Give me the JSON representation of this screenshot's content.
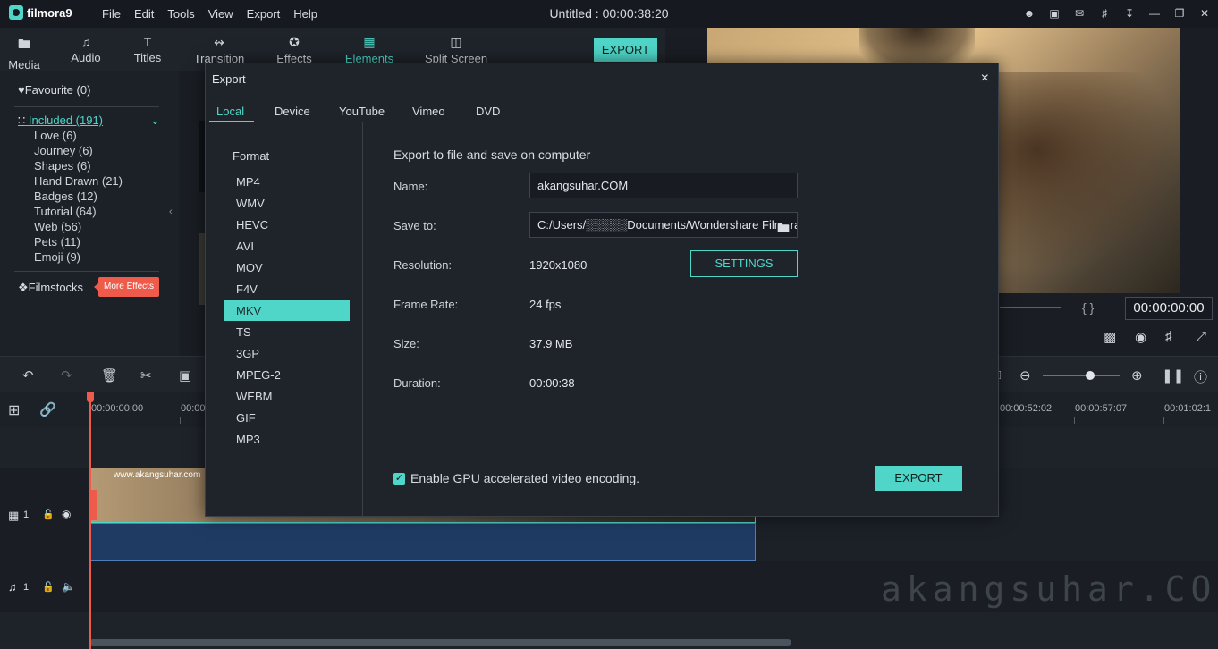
{
  "app": {
    "logo_text": "filmora9",
    "window_title": "Untitled : 00:00:38:20",
    "menu": [
      "File",
      "Edit",
      "Tools",
      "View",
      "Export",
      "Help"
    ]
  },
  "toolbar": {
    "tools": [
      "Media",
      "Audio",
      "Titles",
      "Transition",
      "Effects",
      "Elements",
      "Split Screen"
    ],
    "active": "Elements",
    "export_label": "EXPORT"
  },
  "library": {
    "favourite": "Favourite (0)",
    "included": "Included (191)",
    "categories": [
      "Love (6)",
      "Journey (6)",
      "Shapes (6)",
      "Hand Drawn (21)",
      "Badges (12)",
      "Tutorial (64)",
      "Web (56)",
      "Pets (11)",
      "Emoji (9)"
    ],
    "filmstocks": "Filmstocks",
    "more_effects": "More Effects"
  },
  "preview": {
    "timecode": "00:00:00:00",
    "braces": "{  }"
  },
  "timeline": {
    "ruler_labels": [
      "00:00:00:00",
      "00:00",
      "00:00:52:02",
      "00:00:57:07",
      "00:01:02:1"
    ],
    "video_track_label": "1",
    "audio_track_label": "1",
    "clip_watermark": "www.akangsuhar.com"
  },
  "watermark": "akangsuhar.COM",
  "dialog": {
    "title": "Export",
    "close": "×",
    "tabs": [
      "Local",
      "Device",
      "YouTube",
      "Vimeo",
      "DVD"
    ],
    "active_tab": "Local",
    "format_heading": "Format",
    "formats": [
      "MP4",
      "WMV",
      "HEVC",
      "AVI",
      "MOV",
      "F4V",
      "MKV",
      "TS",
      "3GP",
      "MPEG-2",
      "WEBM",
      "GIF",
      "MP3"
    ],
    "selected_format": "MKV",
    "heading": "Export to file and save on computer",
    "name_label": "Name:",
    "name_value": "akangsuhar.COM",
    "saveto_label": "Save to:",
    "saveto_value": "C:/Users/░░░░░Documents/Wondershare Filmora",
    "resolution_label": "Resolution:",
    "resolution_value": "1920x1080",
    "settings_label": "SETTINGS",
    "framerate_label": "Frame Rate:",
    "framerate_value": "24 fps",
    "size_label": "Size:",
    "size_value": "37.9 MB",
    "duration_label": "Duration:",
    "duration_value": "00:00:38",
    "gpu_label": "Enable GPU accelerated video encoding.",
    "gpu_checked": true,
    "export_label": "EXPORT"
  }
}
